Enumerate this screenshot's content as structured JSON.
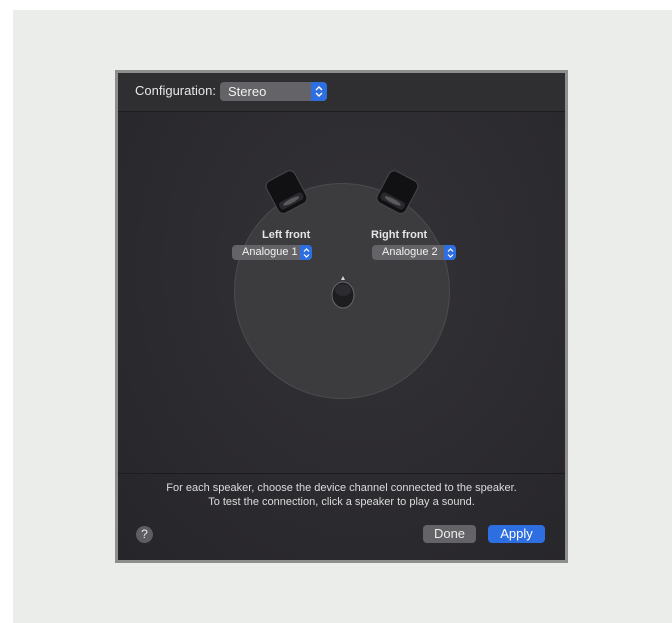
{
  "configuration": {
    "label": "Configuration:",
    "selected": "Stereo"
  },
  "speakers": [
    {
      "label": "Left front",
      "channel": "Analogue 1"
    },
    {
      "label": "Right front",
      "channel": "Analogue 2"
    }
  ],
  "instructions": [
    "For each speaker, choose the device channel connected to the speaker.",
    "To test the connection, click a speaker to play a sound."
  ],
  "buttons": {
    "help": "?",
    "done": "Done",
    "apply": "Apply"
  },
  "colors": {
    "accent": "#2d6fe0",
    "panel": "#2c2b2f"
  }
}
